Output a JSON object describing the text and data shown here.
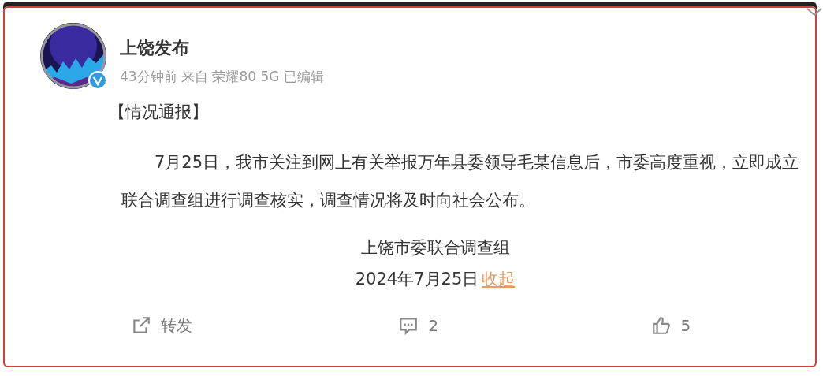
{
  "post": {
    "author": "上饶发布",
    "verified": true,
    "meta": "43分钟前 来自 荣耀80 5G 已编辑",
    "heading": "【情况通报】",
    "body": "7月25日，我市关注到网上有关举报万年县委领导毛某信息后，市委高度重视，立即成立联合调查组进行调查核实，调查情况将及时向社会公布。",
    "signature": "上饶市委联合调查组",
    "date": "2024年7月25日",
    "collapse_link": "收起"
  },
  "actions": [
    {
      "kind": "repost",
      "label": "转发"
    },
    {
      "kind": "comment",
      "label": "2"
    },
    {
      "kind": "like",
      "label": "5"
    }
  ]
}
